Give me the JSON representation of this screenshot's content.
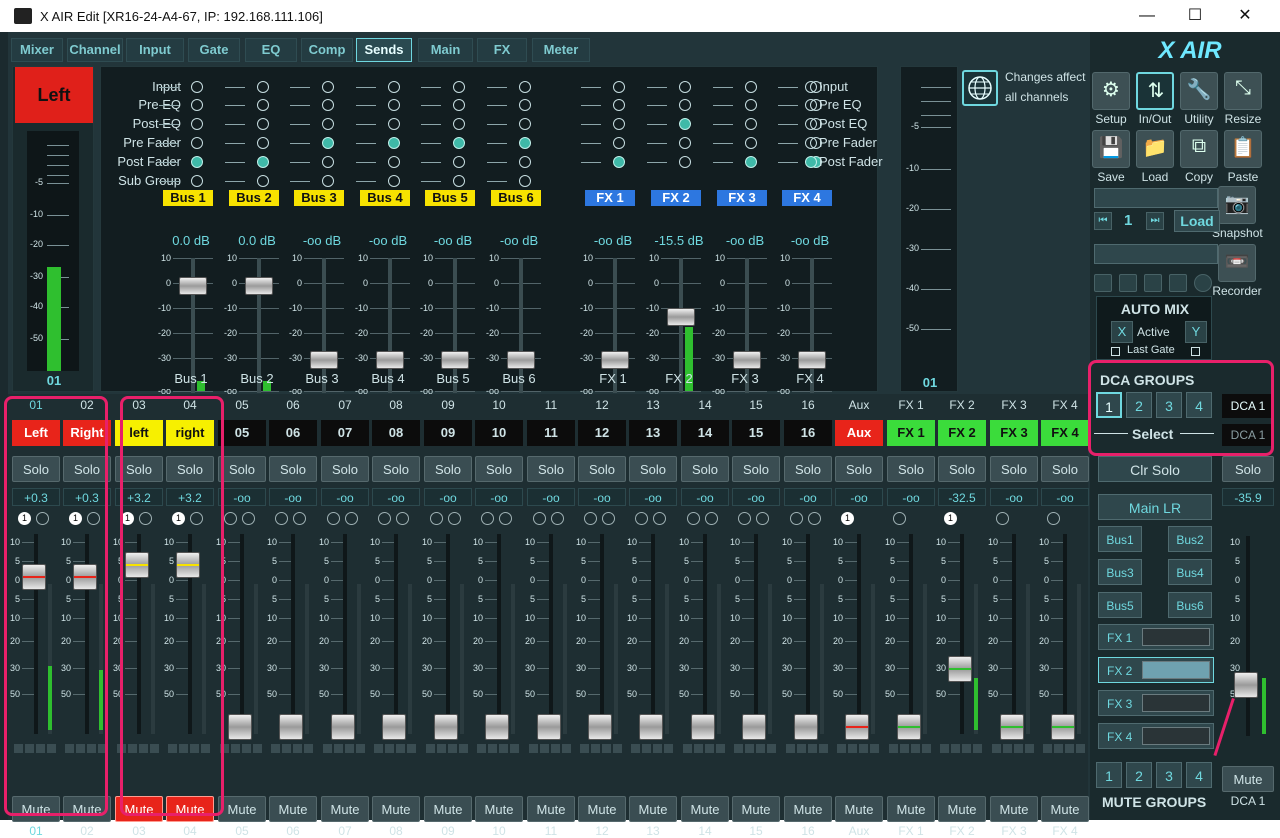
{
  "window": {
    "title": "X AIR Edit [XR16-24-A4-67, IP: 192.168.111.106]",
    "minimize": "—",
    "maximize": "☐",
    "close": "✕"
  },
  "tabs": [
    "Mixer",
    "Channel",
    "Input",
    "Gate",
    "EQ",
    "Comp",
    "Sends",
    "Main",
    "FX",
    "Meter"
  ],
  "active_tab": "Sends",
  "left_box": {
    "label": "Left",
    "channel_number": "01"
  },
  "tap_points": [
    "Input",
    "Pre EQ",
    "Post EQ",
    "Pre Fader",
    "Post Fader",
    "Sub Group"
  ],
  "fx_tap_points": [
    "Input",
    "Pre EQ",
    "Post EQ",
    "Pre Fader",
    "Post Fader"
  ],
  "buses": [
    {
      "name": "Bus 1",
      "level": "0.0 dB",
      "label": "Bus 1",
      "tap": 4
    },
    {
      "name": "Bus 2",
      "level": "0.0 dB",
      "label": "Bus 2",
      "tap": 4
    },
    {
      "name": "Bus 3",
      "level": "-oo dB",
      "label": "Bus 3",
      "tap": 3
    },
    {
      "name": "Bus 4",
      "level": "-oo dB",
      "label": "Bus 4",
      "tap": 3
    },
    {
      "name": "Bus 5",
      "level": "-oo dB",
      "label": "Bus 5",
      "tap": 3
    },
    {
      "name": "Bus 6",
      "level": "-oo dB",
      "label": "Bus 6",
      "tap": 3
    }
  ],
  "fx_sends": [
    {
      "name": "FX 1",
      "level": "-oo dB",
      "label": "FX 1",
      "tap": 4
    },
    {
      "name": "FX 2",
      "level": "-15.5 dB",
      "label": "FX 2",
      "tap": 2
    },
    {
      "name": "FX 3",
      "level": "-oo dB",
      "label": "FX 3",
      "tap": 4
    },
    {
      "name": "FX 4",
      "level": "-oo dB",
      "label": "FX 4",
      "tap": 4
    }
  ],
  "send_scale": [
    "10",
    "0",
    "-10",
    "-20",
    "-30",
    "-oo"
  ],
  "meter_scale": [
    "-5",
    "-10",
    "-20",
    "-30",
    "-40",
    "-50"
  ],
  "right_meter_scale": [
    "-5",
    "-10",
    "-20",
    "-30",
    "-40",
    "-50"
  ],
  "right_meter_number": "01",
  "changes_affect": "Changes affect",
  "all_channels": "all channels",
  "channels": [
    {
      "num": "01",
      "name": "Left",
      "gain": "+0.3",
      "solo": "Solo",
      "mute": "Mute",
      "muted": false,
      "name_color": "red"
    },
    {
      "num": "02",
      "name": "Right",
      "gain": "+0.3",
      "solo": "Solo",
      "mute": "Mute",
      "muted": false,
      "name_color": "red"
    },
    {
      "num": "03",
      "name": "left",
      "gain": "+3.2",
      "solo": "Solo",
      "mute": "Mute",
      "muted": true,
      "name_color": "yellow"
    },
    {
      "num": "04",
      "name": "right",
      "gain": "+3.2",
      "solo": "Solo",
      "mute": "Mute",
      "muted": true,
      "name_color": "yellow"
    },
    {
      "num": "05",
      "name": "05",
      "gain": "-oo",
      "solo": "Solo",
      "mute": "Mute",
      "muted": false,
      "name_color": "black"
    },
    {
      "num": "06",
      "name": "06",
      "gain": "-oo",
      "solo": "Solo",
      "mute": "Mute",
      "muted": false,
      "name_color": "black"
    },
    {
      "num": "07",
      "name": "07",
      "gain": "-oo",
      "solo": "Solo",
      "mute": "Mute",
      "muted": false,
      "name_color": "black"
    },
    {
      "num": "08",
      "name": "08",
      "gain": "-oo",
      "solo": "Solo",
      "mute": "Mute",
      "muted": false,
      "name_color": "black"
    },
    {
      "num": "09",
      "name": "09",
      "gain": "-oo",
      "solo": "Solo",
      "mute": "Mute",
      "muted": false,
      "name_color": "black"
    },
    {
      "num": "10",
      "name": "10",
      "gain": "-oo",
      "solo": "Solo",
      "mute": "Mute",
      "muted": false,
      "name_color": "black"
    },
    {
      "num": "11",
      "name": "11",
      "gain": "-oo",
      "solo": "Solo",
      "mute": "Mute",
      "muted": false,
      "name_color": "black"
    },
    {
      "num": "12",
      "name": "12",
      "gain": "-oo",
      "solo": "Solo",
      "mute": "Mute",
      "muted": false,
      "name_color": "black"
    },
    {
      "num": "13",
      "name": "13",
      "gain": "-oo",
      "solo": "Solo",
      "mute": "Mute",
      "muted": false,
      "name_color": "black"
    },
    {
      "num": "14",
      "name": "14",
      "gain": "-oo",
      "solo": "Solo",
      "mute": "Mute",
      "muted": false,
      "name_color": "black"
    },
    {
      "num": "15",
      "name": "15",
      "gain": "-oo",
      "solo": "Solo",
      "mute": "Mute",
      "muted": false,
      "name_color": "black"
    },
    {
      "num": "16",
      "name": "16",
      "gain": "-oo",
      "solo": "Solo",
      "mute": "Mute",
      "muted": false,
      "name_color": "black"
    },
    {
      "num": "Aux",
      "name": "Aux",
      "gain": "-oo",
      "solo": "Solo",
      "mute": "Mute",
      "muted": false,
      "name_color": "red"
    },
    {
      "num": "FX 1",
      "name": "FX 1",
      "gain": "-oo",
      "solo": "Solo",
      "mute": "Mute",
      "muted": false,
      "name_color": "green"
    },
    {
      "num": "FX 2",
      "name": "FX 2",
      "gain": "-32.5",
      "solo": "Solo",
      "mute": "Mute",
      "muted": false,
      "name_color": "green"
    },
    {
      "num": "FX 3",
      "name": "FX 3",
      "gain": "-oo",
      "solo": "Solo",
      "mute": "Mute",
      "muted": false,
      "name_color": "green"
    },
    {
      "num": "FX 4",
      "name": "FX 4",
      "gain": "-oo",
      "solo": "Solo",
      "mute": "Mute",
      "muted": false,
      "name_color": "green"
    }
  ],
  "fader_scale": [
    "10",
    "5",
    "0",
    "5",
    "10",
    "20",
    "30",
    "50"
  ],
  "dot_label": "1",
  "right_panel": {
    "logo": "X AIR",
    "icons": [
      "Setup",
      "In/Out",
      "Utility",
      "Resize",
      "Save",
      "Load",
      "Copy",
      "Paste",
      "Snapshot",
      "Recorder"
    ],
    "snapshot_number": "1",
    "load_label": "Load",
    "prev_icon": "⏮",
    "next_icon": "⏭",
    "auto_mix": "AUTO MIX",
    "active": "Active",
    "x": "X",
    "y": "Y",
    "last_gate": "Last Gate",
    "dca_groups": "DCA GROUPS",
    "dca_numbers": [
      "1",
      "2",
      "3",
      "4"
    ],
    "select": "Select",
    "clr_solo": "Clr Solo",
    "main_lr": "Main LR",
    "bus_buttons": [
      "Bus1",
      "Bus2",
      "Bus3",
      "Bus4",
      "Bus5",
      "Bus6"
    ],
    "fx_buttons": [
      "FX 1",
      "FX 2",
      "FX 3",
      "FX 4"
    ],
    "mute_numbers": [
      "1",
      "2",
      "3",
      "4"
    ],
    "mute_groups": "MUTE GROUPS"
  },
  "dca_strip": {
    "label": "DCA 1",
    "label2": "DCA 1",
    "solo": "Solo",
    "gain": "-35.9",
    "mute": "Mute",
    "num": "DCA 1"
  }
}
